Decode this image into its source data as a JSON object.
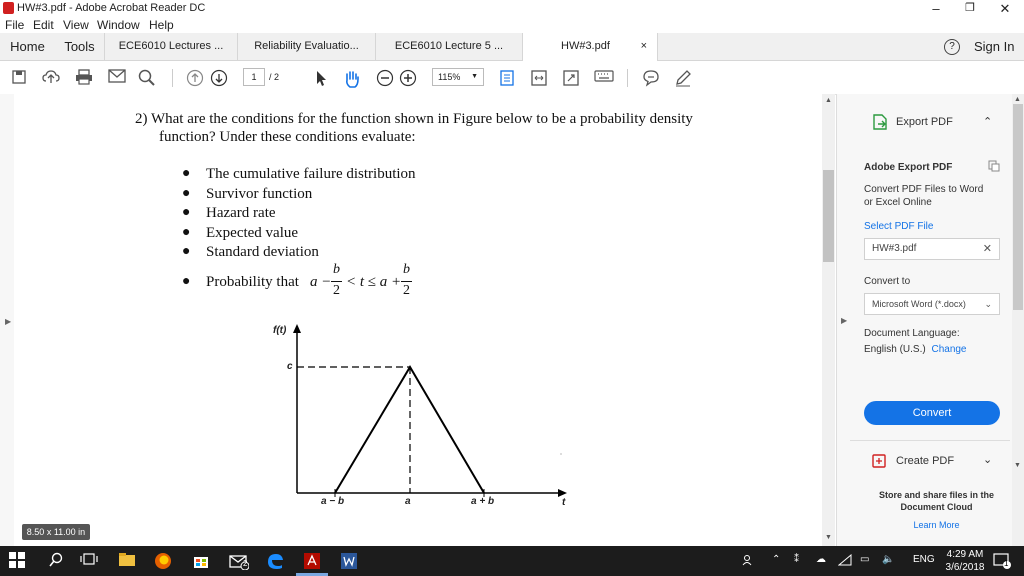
{
  "window": {
    "title": "HW#3.pdf - Adobe Acrobat Reader DC",
    "minimize": "–",
    "maximize": "❐",
    "close": "✕"
  },
  "menu": [
    "File",
    "Edit",
    "View",
    "Window",
    "Help"
  ],
  "tabs": {
    "home": "Home",
    "tools": "Tools",
    "docs": [
      "ECE6010 Lectures ...",
      "Reliability Evaluatio...",
      "ECE6010 Lecture 5 ...",
      "HW#3.pdf"
    ],
    "active_close": "×",
    "help": "?",
    "sign_in": "Sign In"
  },
  "toolbar": {
    "page_current": "1",
    "page_total": "/ 2",
    "zoom": "115%"
  },
  "document": {
    "question_line1": "2)  What are the conditions for the function shown in Figure below to be a probability density",
    "question_line2": "function? Under these conditions evaluate:",
    "bullets": [
      "The cumulative failure distribution",
      "Survivor function",
      "Hazard rate",
      "Expected value",
      "Standard deviation"
    ],
    "prob_prefix": "Probability that",
    "prob_expr": {
      "a1": "a −",
      "b_num": "b",
      "den": "2",
      "mid": "< t ≤ a +",
      "b_num2": "b",
      "den2": "2"
    },
    "figure": {
      "y_label": "f(t)",
      "c_label": "c",
      "x_ticks": [
        "a − b",
        "a",
        "a + b"
      ],
      "x_axis_label": "t"
    }
  },
  "right_pane": {
    "export_pdf": "Export PDF",
    "adobe_export": "Adobe Export PDF",
    "convert_desc": "Convert PDF Files to Word or Excel Online",
    "select_file": "Select PDF File",
    "file_name": "HW#3.pdf",
    "convert_to": "Convert to",
    "format": "Microsoft Word (*.docx)",
    "doc_lang_label": "Document Language:",
    "doc_lang": "English (U.S.)",
    "change": "Change",
    "convert_btn": "Convert",
    "create_pdf": "Create PDF",
    "store_share": "Store and share files in the Document Cloud",
    "learn_more": "Learn More"
  },
  "status": {
    "page_size": "8.50 x 11.00 in"
  },
  "taskbar": {
    "lang": "ENG",
    "time": "4:29 AM",
    "date": "3/6/2018",
    "notif_count": "1",
    "mail_badge": "2"
  },
  "colors": {
    "accent_blue": "#1473e6",
    "acrobat_red": "#d02020",
    "taskbar": "#1c1c1c"
  }
}
